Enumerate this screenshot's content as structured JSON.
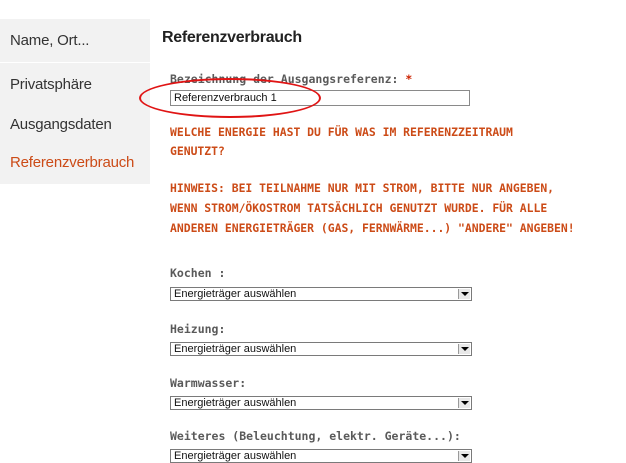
{
  "sidebar": {
    "items": [
      {
        "label": "Name, Ort...",
        "active": false
      },
      {
        "label": "Privatsphäre",
        "active": false
      },
      {
        "label": "Ausgangsdaten",
        "active": false
      },
      {
        "label": "Referenzverbrauch",
        "active": true
      }
    ]
  },
  "main": {
    "title": "Referenzverbrauch",
    "reference_name": {
      "label": "Bezeichnung der Ausgangsreferenz:",
      "required_mark": "*",
      "value": "Referenzverbrauch 1"
    },
    "question_lines": [
      "WELCHE ENERGIE HAST DU FÜR WAS IM REFERENZZEITRAUM",
      "GENUTZT?"
    ],
    "hint_lines": [
      "HINWEIS: BEI TEILNAHME NUR MIT STROM, BITTE NUR ANGEBEN,",
      "WENN STROM/ÖKOSTROM TATSÄCHLICH GENUTZT WURDE. FÜR ALLE",
      "ANDEREN ENERGIETRÄGER (GAS, FERNWÄRME...) \"ANDERE\" ANGEBEN!"
    ],
    "selects": [
      {
        "label": "Kochen :",
        "value": "Energieträger auswählen"
      },
      {
        "label": "Heizung:",
        "value": "Energieträger auswählen"
      },
      {
        "label": "Warmwasser:",
        "value": "Energieträger auswählen"
      },
      {
        "label": "Weiteres (Beleuchtung, elektr. Geräte...):",
        "value": "Energieträger auswählen"
      }
    ]
  },
  "colors": {
    "accent_orange": "#cc4b17",
    "highlight_red": "#e01414",
    "sidebar_bg": "#f2f2f2"
  }
}
